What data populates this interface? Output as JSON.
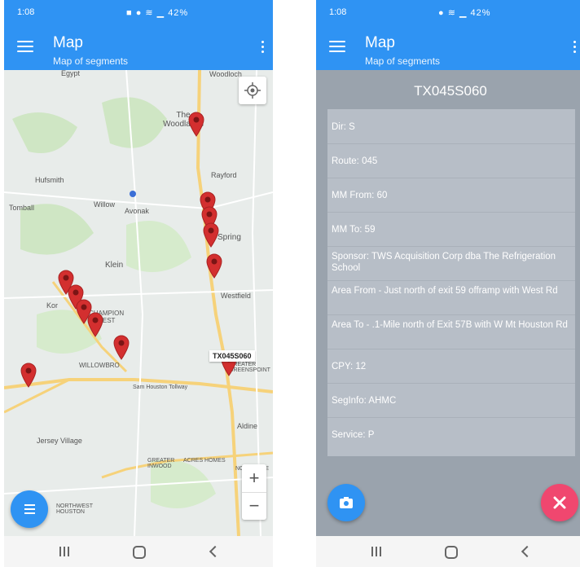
{
  "left_phone": {
    "status": {
      "time": "1:08",
      "icons_text": "■ ● ≋ ▁ 42%"
    },
    "app_bar": {
      "title": "Map",
      "subtitle": "Map of segments"
    },
    "map": {
      "places": [
        "The Woodlands",
        "Rayford",
        "Hufsmith",
        "Tomball",
        "Willow",
        "Avonak",
        "Spring",
        "Klein",
        "Westfield",
        "Kor",
        "CHAMPION FOREST",
        "WILLOWBRO",
        "Sam Houston Tollway",
        "GREATER GREENSPOINT",
        "Aldine",
        "Jersey Village",
        "GREATER INWOOD",
        "ACRES HOMES",
        "NORTHSIDE",
        "NORTHWEST HOUSTON",
        "Woodloch",
        "Egypt"
      ],
      "marker_label": "TX045S060",
      "markers": [
        {
          "id": "marker-1"
        },
        {
          "id": "marker-2"
        },
        {
          "id": "marker-3"
        },
        {
          "id": "marker-4"
        },
        {
          "id": "marker-5"
        },
        {
          "id": "marker-6"
        },
        {
          "id": "marker-7"
        },
        {
          "id": "marker-8"
        },
        {
          "id": "marker-9"
        },
        {
          "id": "marker-10"
        },
        {
          "id": "marker-11"
        },
        {
          "id": "marker-12"
        },
        {
          "id": "marker-13"
        }
      ],
      "zoom_in": "+",
      "zoom_out": "−"
    }
  },
  "right_phone": {
    "status": {
      "time": "1:08",
      "icons_text": "● ≋ ▁ 42%"
    },
    "app_bar": {
      "title": "Map",
      "subtitle": "Map of segments"
    },
    "segment_id": "TX045S060",
    "details": [
      "Dir: S",
      "Route: 045",
      "MM From: 60",
      "MM To: 59",
      "Sponsor: TWS Acquisition Corp dba The Refrigeration School",
      "Area From - Just north of exit 59 offramp with West Rd",
      "Area To - .1-Mile north of Exit 57B with W Mt Houston Rd",
      "CPY: 12",
      "SegInfo: AHMC",
      "Service: P"
    ]
  },
  "colors": {
    "primary": "#2f93f3",
    "accent": "#f0476f",
    "marker": "#d32f2f",
    "detail_bg": "#9aa3ad"
  }
}
